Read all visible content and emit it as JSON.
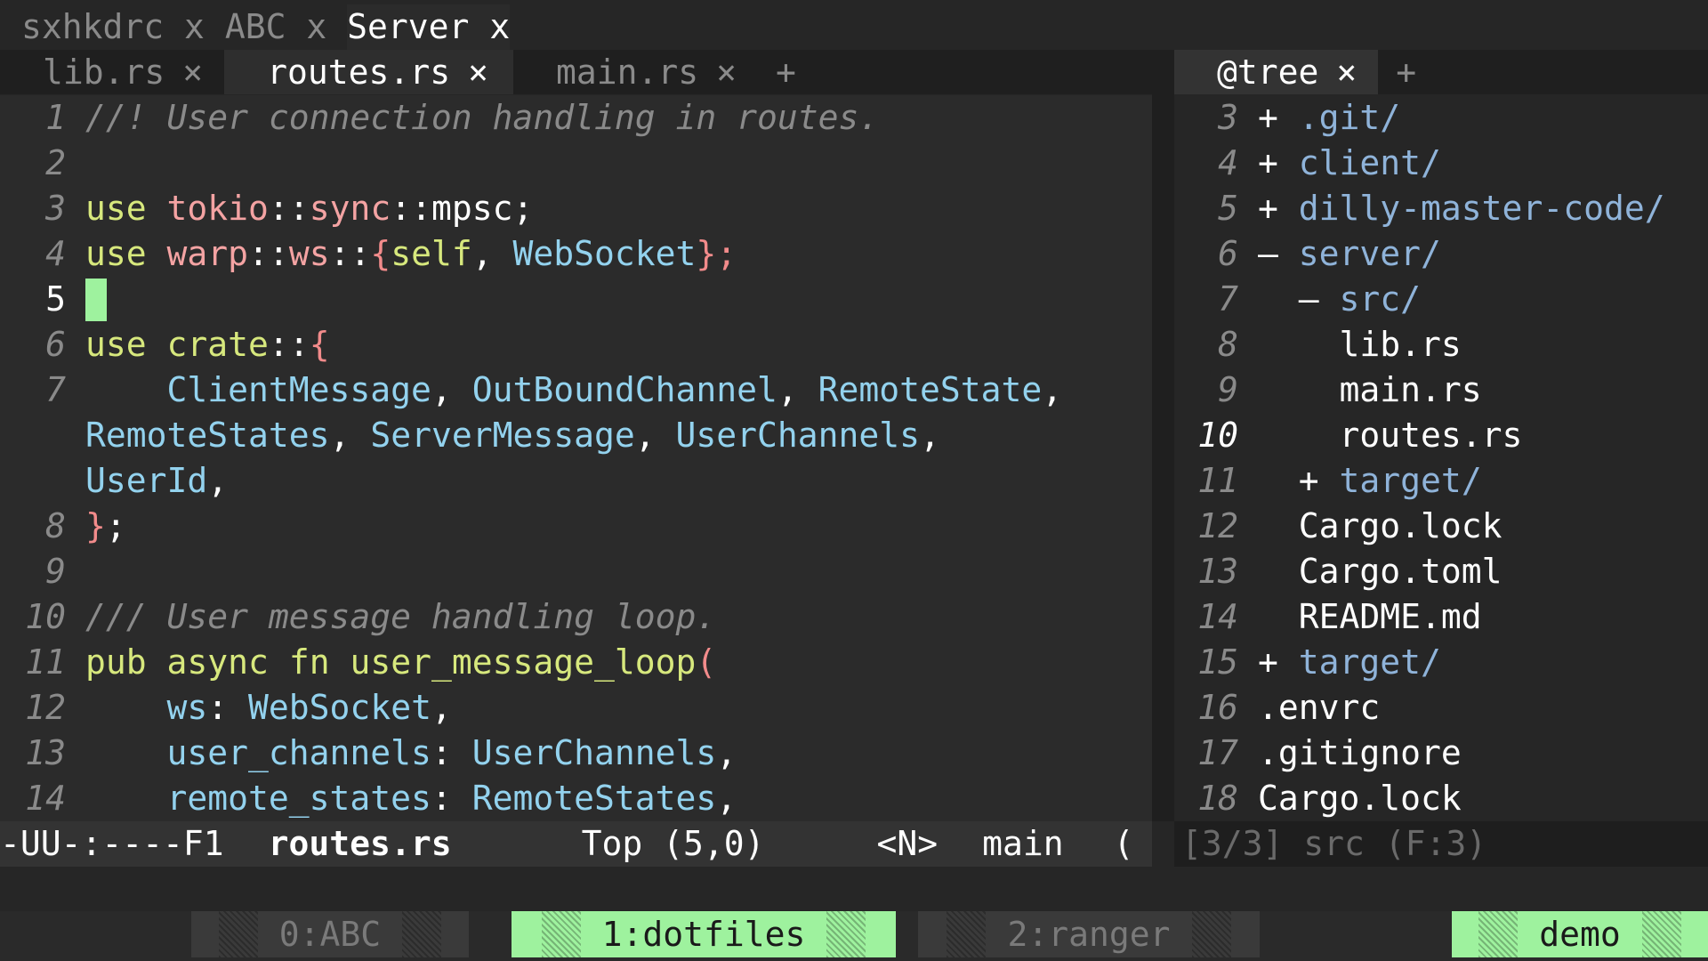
{
  "workspace_tabs": [
    {
      "label": "sxhkdrc",
      "close": "x",
      "active": false
    },
    {
      "label": "ABC",
      "close": "x",
      "active": false
    },
    {
      "label": "Server",
      "close": "x",
      "active": true
    }
  ],
  "buffer_tabs": [
    {
      "label": "lib.rs",
      "close": "×"
    },
    {
      "label": "routes.rs",
      "close": "×"
    },
    {
      "label": "main.rs",
      "close": "×"
    }
  ],
  "buffer_plus": "+",
  "side_tab": {
    "label": "@tree",
    "close": "×",
    "plus": "+"
  },
  "editor": {
    "lines": {
      "l1": {
        "n": "1",
        "comment": "//! User connection handling in routes."
      },
      "l2": {
        "n": "2"
      },
      "l3": {
        "n": "3",
        "use": "use",
        "a": "tokio",
        "s1": "::",
        "b": "sync",
        "s2": "::",
        "c": "mpsc;"
      },
      "l4": {
        "n": "4",
        "use": "use",
        "a": "warp",
        "s1": "::",
        "b": "ws",
        "s2": "::",
        "brace": "{",
        "self": "self",
        "comma": ", ",
        "ws": "WebSocket",
        "end": "};"
      },
      "l5": {
        "n": "5"
      },
      "l6": {
        "n": "6",
        "use": "use",
        "crate": "crate",
        "s1": "::",
        "brace": "{"
      },
      "l7": {
        "n": "7",
        "indent": "    ",
        "t1": "ClientMessage",
        "c1": ", ",
        "t2": "OutBoundChannel",
        "c2": ", ",
        "t3": "RemoteState",
        "c3": ","
      },
      "l7b": {
        "t1": "RemoteStates",
        "c1": ", ",
        "t2": "ServerMessage",
        "c2": ", ",
        "t3": "UserChannels",
        "c3": ","
      },
      "l7c": {
        "t1": "UserId",
        "c1": ","
      },
      "l8": {
        "n": "8",
        "brace": "}",
        "semi": ";"
      },
      "l9": {
        "n": "9"
      },
      "l10": {
        "n": "10",
        "comment": "/// User message handling loop."
      },
      "l11": {
        "n": "11",
        "pub": "pub",
        "async": "async",
        "fn": "fn",
        "name": "user_message_loop",
        "paren": "("
      },
      "l12": {
        "n": "12",
        "indent": "    ",
        "arg": "ws",
        "colon": ": ",
        "ty": "WebSocket",
        "comma": ","
      },
      "l13": {
        "n": "13",
        "indent": "    ",
        "arg": "user_channels",
        "colon": ": ",
        "ty": "UserChannels",
        "comma": ","
      },
      "l14": {
        "n": "14",
        "indent": "    ",
        "arg": "remote_states",
        "colon": ": ",
        "ty": "RemoteStates",
        "comma": ","
      }
    }
  },
  "tree": [
    {
      "n": "3",
      "indent": "",
      "sym": "+",
      "name": ".git/",
      "kind": "dir"
    },
    {
      "n": "4",
      "indent": "",
      "sym": "+",
      "name": "client/",
      "kind": "dir"
    },
    {
      "n": "5",
      "indent": "",
      "sym": "+",
      "name": "dilly-master-code/",
      "kind": "dir"
    },
    {
      "n": "6",
      "indent": "",
      "sym": "–",
      "name": "server/",
      "kind": "dir"
    },
    {
      "n": "7",
      "indent": "  ",
      "sym": "–",
      "name": "src/",
      "kind": "dir"
    },
    {
      "n": "8",
      "indent": "    ",
      "sym": "",
      "name": "lib.rs",
      "kind": "file"
    },
    {
      "n": "9",
      "indent": "    ",
      "sym": "",
      "name": "main.rs",
      "kind": "file"
    },
    {
      "n": "10",
      "indent": "    ",
      "sym": "",
      "name": "routes.rs",
      "kind": "file"
    },
    {
      "n": "11",
      "indent": "  ",
      "sym": "+",
      "name": "target/",
      "kind": "dir"
    },
    {
      "n": "12",
      "indent": "  ",
      "sym": "",
      "name": "Cargo.lock",
      "kind": "file"
    },
    {
      "n": "13",
      "indent": "  ",
      "sym": "",
      "name": "Cargo.toml",
      "kind": "file"
    },
    {
      "n": "14",
      "indent": "  ",
      "sym": "",
      "name": "README.md",
      "kind": "file"
    },
    {
      "n": "15",
      "indent": "",
      "sym": "+",
      "name": "target/",
      "kind": "dir"
    },
    {
      "n": "16",
      "indent": "",
      "sym": "",
      "name": ".envrc",
      "kind": "file"
    },
    {
      "n": "17",
      "indent": "",
      "sym": "",
      "name": ".gitignore",
      "kind": "file"
    },
    {
      "n": "18",
      "indent": "",
      "sym": "",
      "name": "Cargo.lock",
      "kind": "file"
    }
  ],
  "modeline": {
    "status": "-UU-:----F1",
    "buffer": "routes.rs",
    "position": "Top (5,0)",
    "mode": "<N>",
    "branch": "main",
    "paren": "("
  },
  "side_modeline": {
    "text": "[3/3] src (F:3)"
  },
  "tmux": [
    {
      "label": "0:ABC",
      "active": false
    },
    {
      "label": "1:dotfiles",
      "active": true
    },
    {
      "label": "2:ranger",
      "active": false
    },
    {
      "label": "demo",
      "active": true
    }
  ],
  "colors": {
    "accent": "#9ef29e",
    "background": "#2b2b2b",
    "keyword": "#d7e87d",
    "type": "#93d2ee",
    "module": "#f4a3a3",
    "dir": "#8fb3d9"
  }
}
